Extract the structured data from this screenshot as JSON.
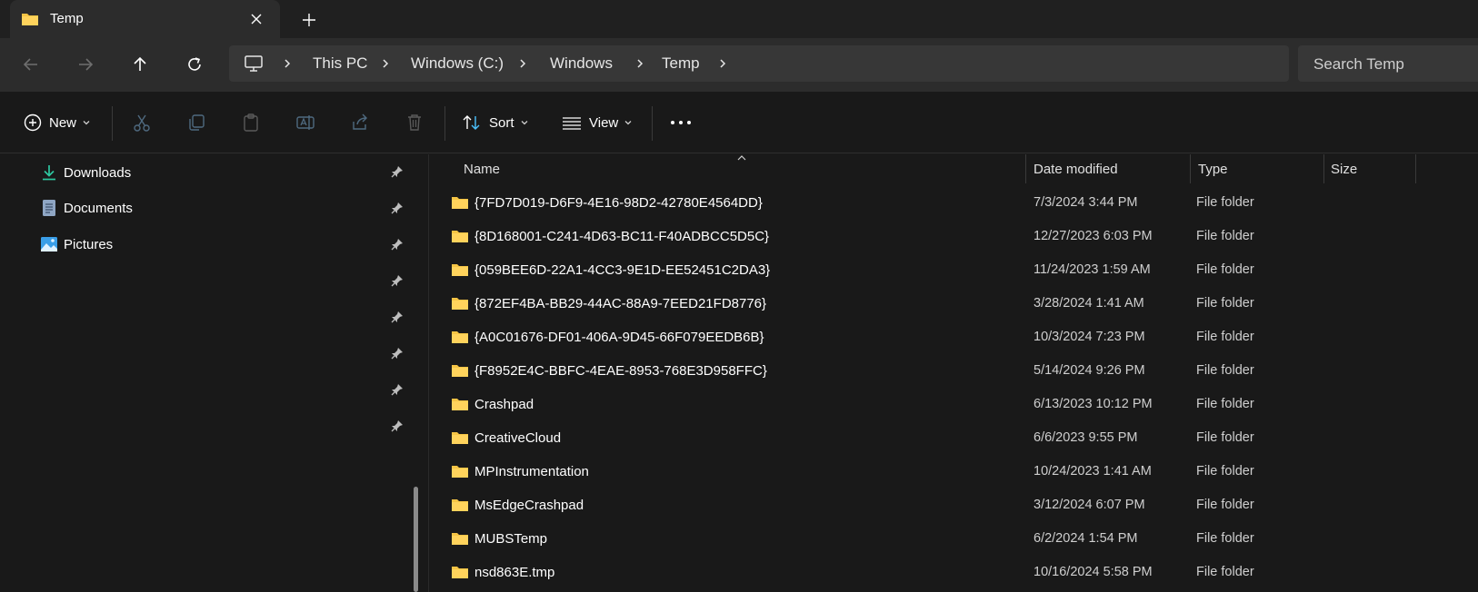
{
  "tab": {
    "title": "Temp"
  },
  "breadcrumb": [
    "This PC",
    "Windows (C:)",
    "Windows",
    "Temp"
  ],
  "search": {
    "placeholder": "Search Temp"
  },
  "commands": {
    "new": "New",
    "sort": "Sort",
    "view": "View"
  },
  "navpane": {
    "items": [
      {
        "label": "Downloads",
        "icon": "download-icon"
      },
      {
        "label": "Documents",
        "icon": "document-icon"
      },
      {
        "label": "Pictures",
        "icon": "pictures-icon"
      }
    ]
  },
  "columns": {
    "name": "Name",
    "date": "Date modified",
    "type": "Type",
    "size": "Size"
  },
  "files": [
    {
      "name": "{7FD7D019-D6F9-4E16-98D2-42780E4564DD}",
      "date": "7/3/2024 3:44 PM",
      "type": "File folder",
      "size": ""
    },
    {
      "name": "{8D168001-C241-4D63-BC11-F40ADBCC5D5C}",
      "date": "12/27/2023 6:03 PM",
      "type": "File folder",
      "size": ""
    },
    {
      "name": "{059BEE6D-22A1-4CC3-9E1D-EE52451C2DA3}",
      "date": "11/24/2023 1:59 AM",
      "type": "File folder",
      "size": ""
    },
    {
      "name": "{872EF4BA-BB29-44AC-88A9-7EED21FD8776}",
      "date": "3/28/2024 1:41 AM",
      "type": "File folder",
      "size": ""
    },
    {
      "name": "{A0C01676-DF01-406A-9D45-66F079EEDB6B}",
      "date": "10/3/2024 7:23 PM",
      "type": "File folder",
      "size": ""
    },
    {
      "name": "{F8952E4C-BBFC-4EAE-8953-768E3D958FFC}",
      "date": "5/14/2024 9:26 PM",
      "type": "File folder",
      "size": ""
    },
    {
      "name": "Crashpad",
      "date": "6/13/2023 10:12 PM",
      "type": "File folder",
      "size": ""
    },
    {
      "name": "CreativeCloud",
      "date": "6/6/2023 9:55 PM",
      "type": "File folder",
      "size": ""
    },
    {
      "name": "MPInstrumentation",
      "date": "10/24/2023 1:41 AM",
      "type": "File folder",
      "size": ""
    },
    {
      "name": "MsEdgeCrashpad",
      "date": "3/12/2024 6:07 PM",
      "type": "File folder",
      "size": ""
    },
    {
      "name": "MUBSTemp",
      "date": "6/2/2024 1:54 PM",
      "type": "File folder",
      "size": ""
    },
    {
      "name": "nsd863E.tmp",
      "date": "10/16/2024 5:58 PM",
      "type": "File folder",
      "size": ""
    }
  ],
  "colors": {
    "folder": "#f5c445",
    "accent": "#4cc2ff"
  }
}
